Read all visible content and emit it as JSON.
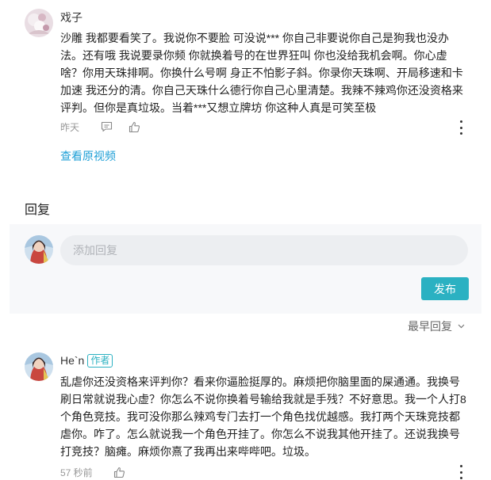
{
  "comment": {
    "username": "戏子",
    "lines": [
      "沙雕 我都要看笑了。我说你不要脸 可没说*** 你自己非要说你自己是狗我也没办",
      "法。还有哦 我说要录你频 你就换着号的在世界狂叫 你也没给我机会啊。你心虚",
      "啥？你用天珠排啊。你换什么号啊 身正不怕影子斜。你录你天珠啊、开局移速和卡",
      "加速 我还分的清。你自己天珠什么德行你自己心里清楚。我辣不辣鸡你还没资格来",
      "评判。但你是真垃圾。当着***又想立牌坊 你这种人真是可笑至极"
    ],
    "time": "昨天",
    "reply_icon": "comment-icon",
    "like_icon": "thumbs-up-icon",
    "more_icon": "more-vertical-icon"
  },
  "view_original_video": "查看原视频",
  "reply_section": {
    "title": "回复",
    "input_placeholder": "添加回复",
    "publish_label": "发布"
  },
  "sort": {
    "label": "最早回复",
    "icon": "chevron-down-icon"
  },
  "reply": {
    "username": "He`n",
    "badge": "作者",
    "lines": [
      "乱虐你还没资格来评判你？看来你逼脸挺厚的。麻烦把你脑里面的屎通通。我换号",
      "刷日常就说我心虚？你怎么不说你换着号输给我就是手残？不好意思。我一个人打8",
      "个角色竞技。我可没你那么辣鸡专门去打一个角色找优越感。我打两个天珠竞技都",
      "虐你。咋了。怎么就说我一个角色开挂了。你怎么不说我其他开挂了。还说我换号",
      "打竞技？脑瘫。麻烦你熹了我再出来哔哔吧。垃圾。"
    ],
    "time": "57 秒前",
    "like_icon": "thumbs-up-icon",
    "more_icon": "more-vertical-icon"
  },
  "colors": {
    "accent": "#2bb1c2",
    "link": "#1e9fd6",
    "panel_bg": "#f7f8fa",
    "input_bg": "#eceef1"
  }
}
